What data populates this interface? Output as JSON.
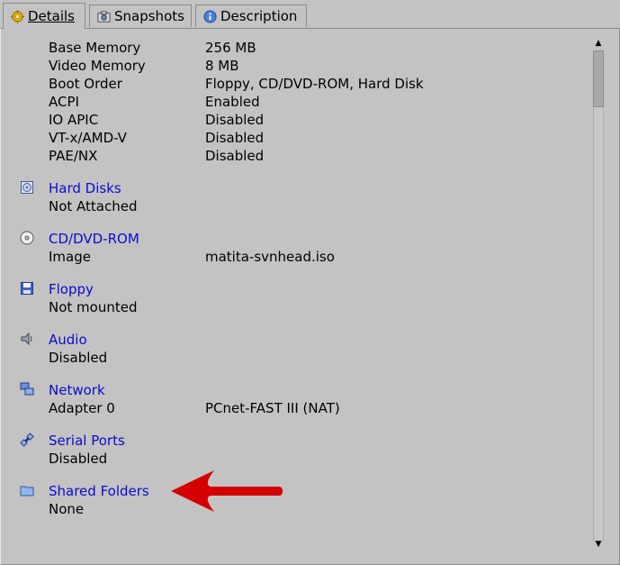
{
  "tabs": [
    {
      "label": "Details",
      "icon": "gear-icon"
    },
    {
      "label": "Snapshots",
      "icon": "camera-icon"
    },
    {
      "label": "Description",
      "icon": "info-icon"
    }
  ],
  "system": {
    "rows": [
      {
        "label": "Base Memory",
        "value": "256 MB"
      },
      {
        "label": "Video Memory",
        "value": "8 MB"
      },
      {
        "label": "Boot Order",
        "value": "Floppy, CD/DVD-ROM, Hard Disk"
      },
      {
        "label": "ACPI",
        "value": "Enabled"
      },
      {
        "label": "IO APIC",
        "value": "Disabled"
      },
      {
        "label": "VT-x/AMD-V",
        "value": "Disabled"
      },
      {
        "label": "PAE/NX",
        "value": "Disabled"
      }
    ]
  },
  "sections": {
    "hard_disks": {
      "title": "Hard Disks",
      "status": "Not Attached",
      "icon": "hard-disk-icon"
    },
    "cdrom": {
      "title": "CD/DVD-ROM",
      "label": "Image",
      "value": "matita-svnhead.iso",
      "icon": "cdrom-icon"
    },
    "floppy": {
      "title": "Floppy",
      "status": "Not mounted",
      "icon": "floppy-icon"
    },
    "audio": {
      "title": "Audio",
      "status": "Disabled",
      "icon": "audio-icon"
    },
    "network": {
      "title": "Network",
      "label": "Adapter 0",
      "value": "PCnet-FAST III (NAT)",
      "icon": "network-icon"
    },
    "serial": {
      "title": "Serial Ports",
      "status": "Disabled",
      "icon": "serial-port-icon"
    },
    "shared": {
      "title": "Shared Folders",
      "status": "None",
      "icon": "folder-icon"
    }
  },
  "colors": {
    "section_title": "#0b0bcc",
    "annotation_arrow": "#d40000",
    "background": "#c3c3c3"
  }
}
